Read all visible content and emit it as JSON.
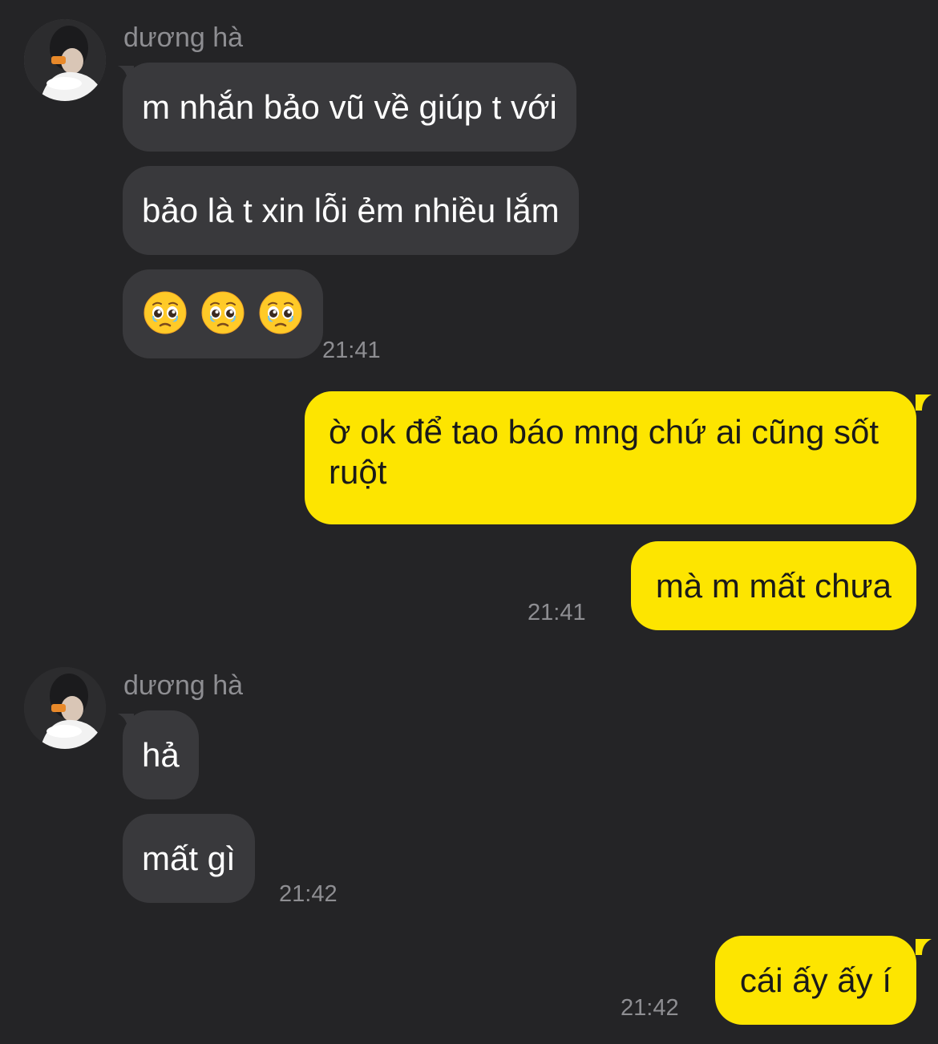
{
  "chat": {
    "colors": {
      "background": "#242426",
      "incoming_bubble": "#39393c",
      "outgoing_bubble": "#fde500",
      "meta_text": "#8e8e92"
    },
    "groups": [
      {
        "sender": "dương hà",
        "avatar": "avatar-photo",
        "messages": [
          {
            "text": "m nhắn bảo vũ về giúp t với"
          },
          {
            "text": "bảo là t xin lỗi ẻm nhiều lắm"
          },
          {
            "emoji": [
              "pleading-face-icon",
              "pleading-face-icon",
              "pleading-face-icon"
            ]
          }
        ],
        "time": "21:41"
      },
      {
        "sender": "me",
        "messages": [
          {
            "text": "ờ ok để tao báo mng chứ ai cũng sốt ruột"
          },
          {
            "text": "mà m mất chưa"
          }
        ],
        "time": "21:41"
      },
      {
        "sender": "dương hà",
        "avatar": "avatar-photo",
        "messages": [
          {
            "text": "hả"
          },
          {
            "text": "mất gì"
          }
        ],
        "time": "21:42"
      },
      {
        "sender": "me",
        "messages": [
          {
            "text": "cái ấy ấy í"
          }
        ],
        "time": "21:42"
      }
    ]
  }
}
